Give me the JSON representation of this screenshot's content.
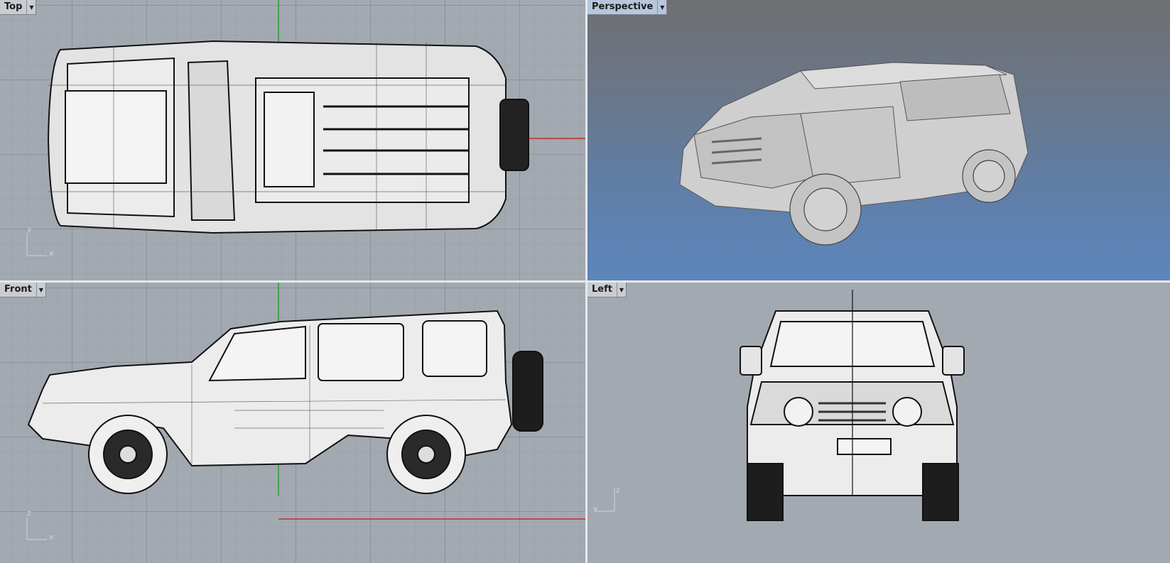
{
  "viewports": {
    "top": {
      "label": "Top",
      "axis_a": "y",
      "axis_b": "x"
    },
    "perspective": {
      "label": "Perspective"
    },
    "front": {
      "label": "Front",
      "axis_a": "z",
      "axis_b": "x"
    },
    "left": {
      "label": "Left",
      "axis_a": "z",
      "axis_b": "y"
    }
  },
  "icons": {
    "dropdown": "triangle-down-icon"
  },
  "colors": {
    "x_axis": "#c0302a",
    "y_axis": "#3aa13a",
    "active_tab": "#b6c7de",
    "grid_bg": "#a3a9b1"
  }
}
